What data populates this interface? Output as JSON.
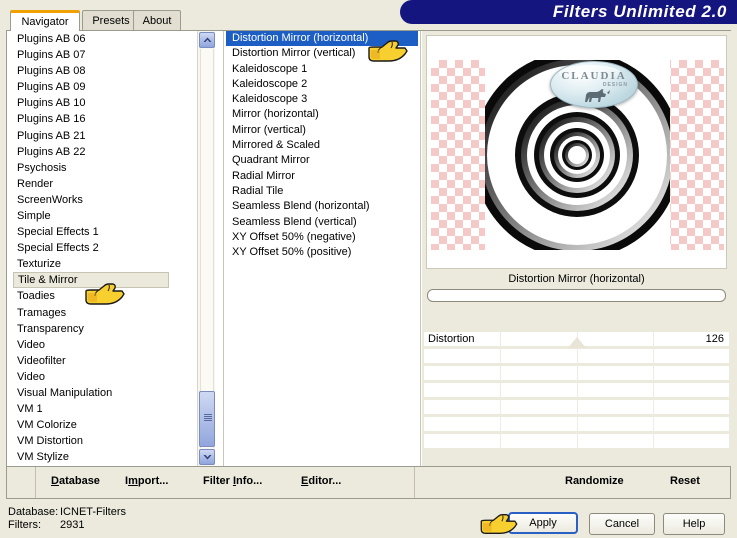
{
  "window": {
    "title": "Filters Unlimited 2.0",
    "title_bg": "#151580",
    "accent_orange": "#f0a000",
    "panel_bg": "#ece9dd",
    "selection_blue": "#1d5ec4"
  },
  "tabs": [
    {
      "label": "Navigator",
      "active": true
    },
    {
      "label": "Presets",
      "active": false
    },
    {
      "label": "About",
      "active": false
    }
  ],
  "categories": {
    "selected": "Tile & Mirror",
    "items": [
      "Plugins AB 06",
      "Plugins AB 07",
      "Plugins AB 08",
      "Plugins AB 09",
      "Plugins AB 10",
      "Plugins AB 16",
      "Plugins AB 21",
      "Plugins AB 22",
      "Psychosis",
      "Render",
      "ScreenWorks",
      "Simple",
      "Special Effects 1",
      "Special Effects 2",
      "Texturize",
      "Tile & Mirror",
      "Toadies",
      "Tramages",
      "Transparency",
      "Video",
      "Videofilter",
      "Video",
      "Visual Manipulation",
      "VM 1",
      "VM Colorize",
      "VM Distortion",
      "VM Stylize"
    ]
  },
  "filters": {
    "selected": "Distortion Mirror (horizontal)",
    "items": [
      "Distortion Mirror (horizontal)",
      "Distortion Mirror (vertical)",
      "Kaleidoscope 1",
      "Kaleidoscope 2",
      "Kaleidoscope 3",
      "Mirror (horizontal)",
      "Mirror (vertical)",
      "Mirrored & Scaled",
      "Quadrant Mirror",
      "Radial Mirror",
      "Radial Tile",
      "Seamless Blend (horizontal)",
      "Seamless Blend (vertical)",
      "XY Offset 50% (negative)",
      "XY Offset 50% (positive)"
    ]
  },
  "preview": {
    "filter_name": "Distortion Mirror (horizontal)",
    "preset_value": "",
    "preset_placeholder": ""
  },
  "parameters": [
    {
      "label": "Distortion",
      "value": "126",
      "position_pct": 50
    },
    {
      "label": "",
      "value": "",
      "position_pct": null
    },
    {
      "label": "",
      "value": "",
      "position_pct": null
    },
    {
      "label": "",
      "value": "",
      "position_pct": null
    },
    {
      "label": "",
      "value": "",
      "position_pct": null
    },
    {
      "label": "",
      "value": "",
      "position_pct": null
    },
    {
      "label": "",
      "value": "",
      "position_pct": null
    }
  ],
  "watermark": {
    "text": "CLAUDIA",
    "subtext": "DESIGN"
  },
  "menu": [
    {
      "label": "Database",
      "mnemonic": "D"
    },
    {
      "label": "Import...",
      "mnemonic": "m"
    },
    {
      "label": "Filter Info...",
      "mnemonic": "I"
    },
    {
      "label": "Editor...",
      "mnemonic": "E"
    }
  ],
  "panel_actions": [
    {
      "label": "Randomize"
    },
    {
      "label": "Reset"
    }
  ],
  "status": {
    "database_key": "Database:",
    "database_value": "ICNET-Filters",
    "filters_key": "Filters:",
    "filters_value": "2931"
  },
  "buttons": [
    {
      "label": "Apply",
      "default": true
    },
    {
      "label": "Cancel",
      "default": false
    },
    {
      "label": "Help",
      "default": false
    }
  ]
}
